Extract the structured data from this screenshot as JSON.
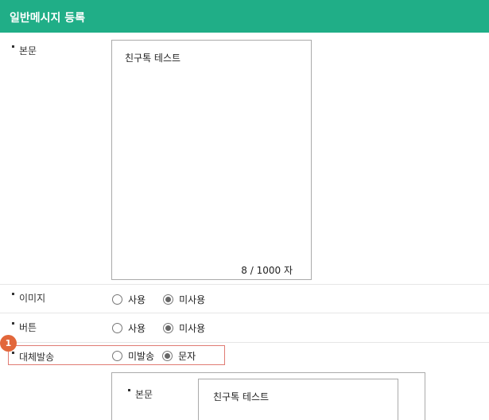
{
  "header": {
    "title": "일반메시지 등록"
  },
  "form": {
    "body": {
      "label": "본문",
      "text": "친구톡 테스트",
      "counter": "8 / 1000 자"
    },
    "image": {
      "label": "이미지",
      "options": [
        {
          "label": "사용",
          "checked": false
        },
        {
          "label": "미사용",
          "checked": true
        }
      ]
    },
    "button": {
      "label": "버튼",
      "options": [
        {
          "label": "사용",
          "checked": false
        },
        {
          "label": "미사용",
          "checked": true
        }
      ]
    },
    "fallback": {
      "label": "대체발송",
      "badge": "1",
      "options": [
        {
          "label": "미발송",
          "checked": false
        },
        {
          "label": "문자",
          "checked": true
        }
      ]
    },
    "fallback_body": {
      "label": "본문",
      "text": "친구톡 테스트"
    }
  },
  "colors": {
    "header_bg": "#20ae87",
    "highlight_border": "#e07b73",
    "badge_bg": "#e2673b"
  }
}
